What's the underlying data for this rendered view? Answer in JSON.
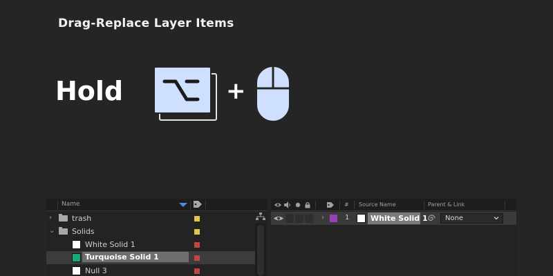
{
  "header": {
    "title": "Drag-Replace Layer Items"
  },
  "shortcut": {
    "hold_label": "Hold",
    "plus": "+",
    "key_icon": "option-key-icon",
    "mouse_icon": "mouse-icon",
    "key_color": "#cfe0ff"
  },
  "project_panel": {
    "column_name": "Name",
    "items": [
      {
        "label": "trash",
        "type": "folder",
        "expanded": false,
        "label_color": "#e0c64a"
      },
      {
        "label": "Solids",
        "type": "folder",
        "expanded": true,
        "label_color": "#e0c64a"
      },
      {
        "label": "White Solid 1",
        "type": "solid",
        "swatch": "#ffffff",
        "label_color": "#c0473f"
      },
      {
        "label": "Turquoise Solid 1",
        "type": "solid",
        "swatch": "#1aa87a",
        "label_color": "#c0473f",
        "selected": true
      },
      {
        "label": "Null 3",
        "type": "solid",
        "swatch": "#ffffff",
        "label_color": "#c0473f"
      }
    ]
  },
  "timeline": {
    "headers": {
      "number": "#",
      "source_name": "Source Name",
      "parent_link": "Parent & Link"
    },
    "layers": [
      {
        "number": "1",
        "source_name": "White Solid 1",
        "label_color": "#9a3fb7",
        "parent": "None"
      }
    ]
  }
}
